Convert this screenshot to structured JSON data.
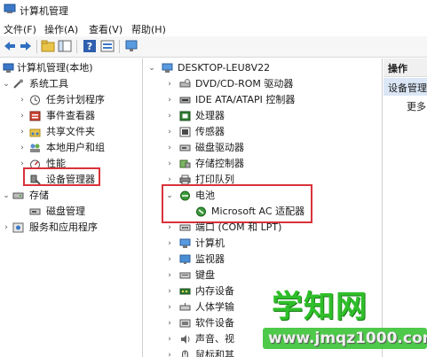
{
  "window": {
    "title": "计算机管理"
  },
  "menu": [
    {
      "id": "file",
      "label": "文件(F)"
    },
    {
      "id": "action",
      "label": "操作(A)"
    },
    {
      "id": "view",
      "label": "查看(V)"
    },
    {
      "id": "help",
      "label": "帮助(H)"
    }
  ],
  "toolbar": {
    "icons": [
      "back-arrow-icon",
      "forward-arrow-icon",
      "folder-up-icon",
      "console-tree-icon",
      "help-icon",
      "properties-icon",
      "monitor-icon"
    ]
  },
  "left_tree": {
    "root": "计算机管理(本地)",
    "system_tools": "系统工具",
    "task_scheduler": "任务计划程序",
    "event_viewer": "事件查看器",
    "shared_folders": "共享文件夹",
    "local_users": "本地用户和组",
    "performance": "性能",
    "device_manager": "设备管理器",
    "storage": "存储",
    "disk_management": "磁盘管理",
    "services": "服务和应用程序"
  },
  "device_tree": {
    "computer": "DESKTOP-LEU8V22",
    "dvd": "DVD/CD-ROM 驱动器",
    "ide": "IDE ATA/ATAPI 控制器",
    "cpu": "处理器",
    "sensors": "传感器",
    "disk": "磁盘驱动器",
    "storage_ctrl": "存储控制器",
    "print_queue": "打印队列",
    "battery": "电池",
    "ac_adapter": "Microsoft AC 适配器",
    "ports": "端口 (COM 和 LPT)",
    "computer_cat": "计算机",
    "monitor": "监视器",
    "keyboard": "键盘",
    "memory": "内存设备",
    "hid": "人体学输",
    "software": "软件设备",
    "audio": "声音、视",
    "mouse": "鼠标和其"
  },
  "actions": {
    "header": "操作",
    "selected": "设备管理",
    "more": "更多"
  },
  "watermark": {
    "main": "学知网",
    "url": "www.jmqz1000.com"
  },
  "colors": {
    "highlight_box": "#d9333b",
    "watermark_green": "#2fbf2a",
    "selection": "#dbe7f6"
  }
}
